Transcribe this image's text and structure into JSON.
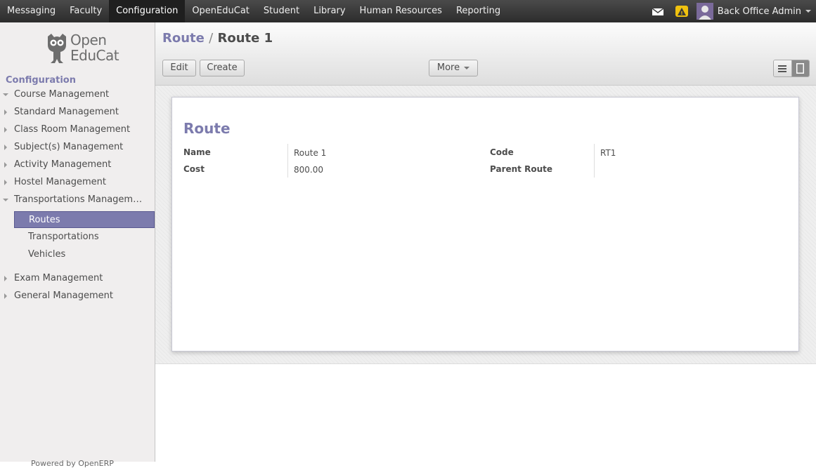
{
  "topmenu": [
    "Messaging",
    "Faculty",
    "Configuration",
    "OpenEduCat",
    "Student",
    "Library",
    "Human Resources",
    "Reporting"
  ],
  "topmenu_active": "Configuration",
  "user": {
    "name": "Back Office Admin",
    "alert_symbol": "!"
  },
  "logo": {
    "line1": "Open",
    "line2": "EduCat"
  },
  "sidebar": {
    "header": "Configuration",
    "items": [
      {
        "label": "Course Management",
        "state": "expanded"
      },
      {
        "label": "Standard Management",
        "state": "collapsed"
      },
      {
        "label": "Class Room Management",
        "state": "collapsed"
      },
      {
        "label": "Subject(s) Management",
        "state": "collapsed"
      },
      {
        "label": "Activity Management",
        "state": "collapsed"
      },
      {
        "label": "Hostel Management",
        "state": "collapsed"
      },
      {
        "label": "Transportations Managem…",
        "state": "expanded"
      }
    ],
    "subitems": [
      {
        "label": "Routes",
        "active": true
      },
      {
        "label": "Transportations",
        "active": false
      },
      {
        "label": "Vehicles",
        "active": false
      }
    ],
    "items_after": [
      {
        "label": "Exam Management",
        "state": "collapsed"
      },
      {
        "label": "General Management",
        "state": "collapsed"
      }
    ],
    "powered_by": "Powered by OpenERP"
  },
  "breadcrumb": {
    "parent": "Route",
    "separator": "/",
    "current": "Route 1"
  },
  "buttons": {
    "edit": "Edit",
    "create": "Create",
    "more": "More"
  },
  "form": {
    "title": "Route",
    "fields": {
      "name_label": "Name",
      "name_value": "Route 1",
      "cost_label": "Cost",
      "cost_value": "800.00",
      "code_label": "Code",
      "code_value": "RT1",
      "parent_label": "Parent Route",
      "parent_value": ""
    }
  },
  "colors": {
    "accent": "#7c7bad",
    "topbar": "#414141",
    "alert": "#f0c20f"
  }
}
